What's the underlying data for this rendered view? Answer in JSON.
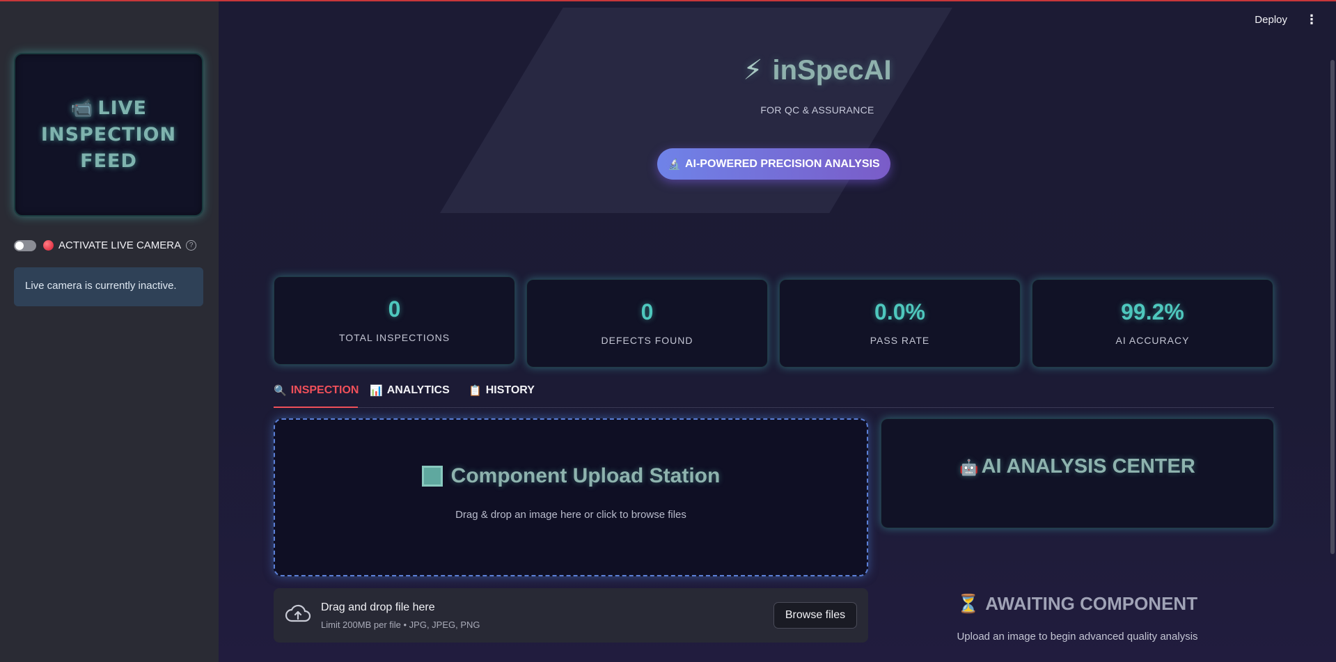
{
  "app": {
    "deploy_label": "Deploy",
    "menu_icon": "⋮"
  },
  "sidebar": {
    "feed_icon": "📹",
    "feed_title": "LIVE INSPECTION FEED",
    "toggle_state": "off",
    "camera_label": "ACTIVATE LIVE CAMERA",
    "help_icon": "?",
    "info_message": "Live camera is currently inactive."
  },
  "hero": {
    "bolt_icon": "⚡",
    "title": "inSpecAI",
    "subtitle": "FOR QC & ASSURANCE",
    "pill_icon": "🔬",
    "pill_label": "AI-POWERED PRECISION ANALYSIS"
  },
  "metrics": [
    {
      "value": "0",
      "label": "TOTAL INSPECTIONS"
    },
    {
      "value": "0",
      "label": "DEFECTS FOUND"
    },
    {
      "value": "0.0%",
      "label": "PASS RATE"
    },
    {
      "value": "99.2%",
      "label": "AI ACCURACY"
    }
  ],
  "tabs": [
    {
      "icon": "🔍",
      "label": "INSPECTION",
      "active": true
    },
    {
      "icon": "📊",
      "label": "ANALYTICS",
      "active": false
    },
    {
      "icon": "📋",
      "label": "HISTORY",
      "active": false
    }
  ],
  "upload_station": {
    "title": "Component Upload Station",
    "subtitle": "Drag & drop an image here or click to browse files"
  },
  "dropzone": {
    "title": "Drag and drop file here",
    "limit": "Limit 200MB per file • JPG, JPEG, PNG",
    "browse_label": "Browse files"
  },
  "ai_center": {
    "icon": "🤖",
    "title": "AI ANALYSIS CENTER"
  },
  "awaiting": {
    "icon": "⏳",
    "title": "AWAITING COMPONENT",
    "subtitle": "Upload an image to begin advanced quality analysis"
  },
  "colors": {
    "accent_teal": "#4ec7bd",
    "active_tab": "#f0505a",
    "pill_gradient_start": "#6f83e8",
    "pill_gradient_end": "#7a5cc8"
  }
}
